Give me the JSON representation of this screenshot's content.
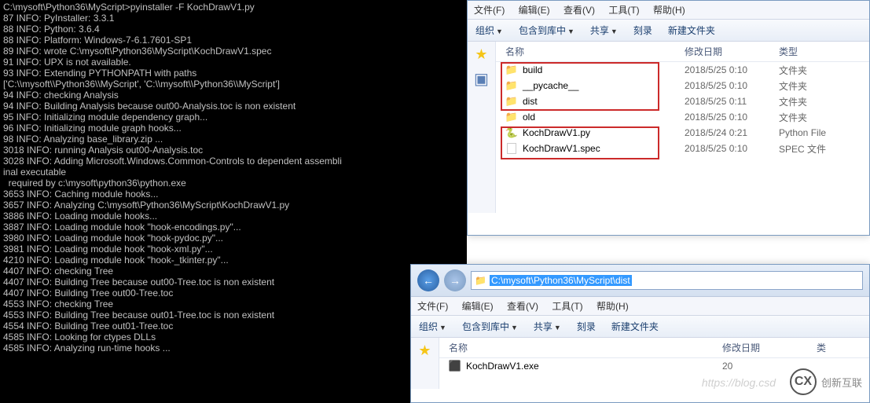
{
  "terminal": {
    "lines": [
      "C:\\mysoft\\Python36\\MyScript>pyinstaller -F KochDrawV1.py",
      "87 INFO: PyInstaller: 3.3.1",
      "88 INFO: Python: 3.6.4",
      "88 INFO: Platform: Windows-7-6.1.7601-SP1",
      "89 INFO: wrote C:\\mysoft\\Python36\\MyScript\\KochDrawV1.spec",
      "91 INFO: UPX is not available.",
      "93 INFO: Extending PYTHONPATH with paths",
      "['C:\\\\mysoft\\\\Python36\\\\MyScript', 'C:\\\\mysoft\\\\Python36\\\\MyScript']",
      "94 INFO: checking Analysis",
      "94 INFO: Building Analysis because out00-Analysis.toc is non existent",
      "95 INFO: Initializing module dependency graph...",
      "96 INFO: Initializing module graph hooks...",
      "98 INFO: Analyzing base_library.zip ...",
      "3018 INFO: running Analysis out00-Analysis.toc",
      "3028 INFO: Adding Microsoft.Windows.Common-Controls to dependent assembli",
      "inal executable",
      "  required by c:\\mysoft\\python36\\python.exe",
      "3653 INFO: Caching module hooks...",
      "3657 INFO: Analyzing C:\\mysoft\\Python36\\MyScript\\KochDrawV1.py",
      "3886 INFO: Loading module hooks...",
      "3887 INFO: Loading module hook \"hook-encodings.py\"...",
      "3980 INFO: Loading module hook \"hook-pydoc.py\"...",
      "3981 INFO: Loading module hook \"hook-xml.py\"...",
      "4210 INFO: Loading module hook \"hook-_tkinter.py\"...",
      "4407 INFO: checking Tree",
      "4407 INFO: Building Tree because out00-Tree.toc is non existent",
      "4407 INFO: Building Tree out00-Tree.toc",
      "4553 INFO: checking Tree",
      "4553 INFO: Building Tree because out01-Tree.toc is non existent",
      "4554 INFO: Building Tree out01-Tree.toc",
      "4585 INFO: Looking for ctypes DLLs",
      "4585 INFO: Analyzing run-time hooks ..."
    ]
  },
  "menus": {
    "file": "文件(F)",
    "edit": "编辑(E)",
    "view": "查看(V)",
    "tools": "工具(T)",
    "help": "帮助(H)"
  },
  "toolbar": {
    "organize": "组织",
    "include": "包含到库中",
    "share": "共享",
    "burn": "刻录",
    "newfolder": "新建文件夹"
  },
  "cols": {
    "name": "名称",
    "date": "修改日期",
    "type": "类型"
  },
  "top_files": [
    {
      "ico": "folder",
      "name": "build",
      "date": "2018/5/25 0:10",
      "type": "文件夹"
    },
    {
      "ico": "folder",
      "name": "__pycache__",
      "date": "2018/5/25 0:10",
      "type": "文件夹"
    },
    {
      "ico": "folder",
      "name": "dist",
      "date": "2018/5/25 0:11",
      "type": "文件夹"
    },
    {
      "ico": "folder",
      "name": "old",
      "date": "2018/5/25 0:10",
      "type": "文件夹"
    },
    {
      "ico": "py",
      "name": "KochDrawV1.py",
      "date": "2018/5/24 0:21",
      "type": "Python File"
    },
    {
      "ico": "spec",
      "name": "KochDrawV1.spec",
      "date": "2018/5/25 0:10",
      "type": "SPEC 文件"
    }
  ],
  "bottom": {
    "path": "C:\\mysoft\\Python36\\MyScript\\dist",
    "files": [
      {
        "ico": "exe",
        "name": "KochDrawV1.exe",
        "date": "20"
      }
    ]
  },
  "watermark": {
    "text": "创新互联",
    "url": "https://blog.csd"
  }
}
